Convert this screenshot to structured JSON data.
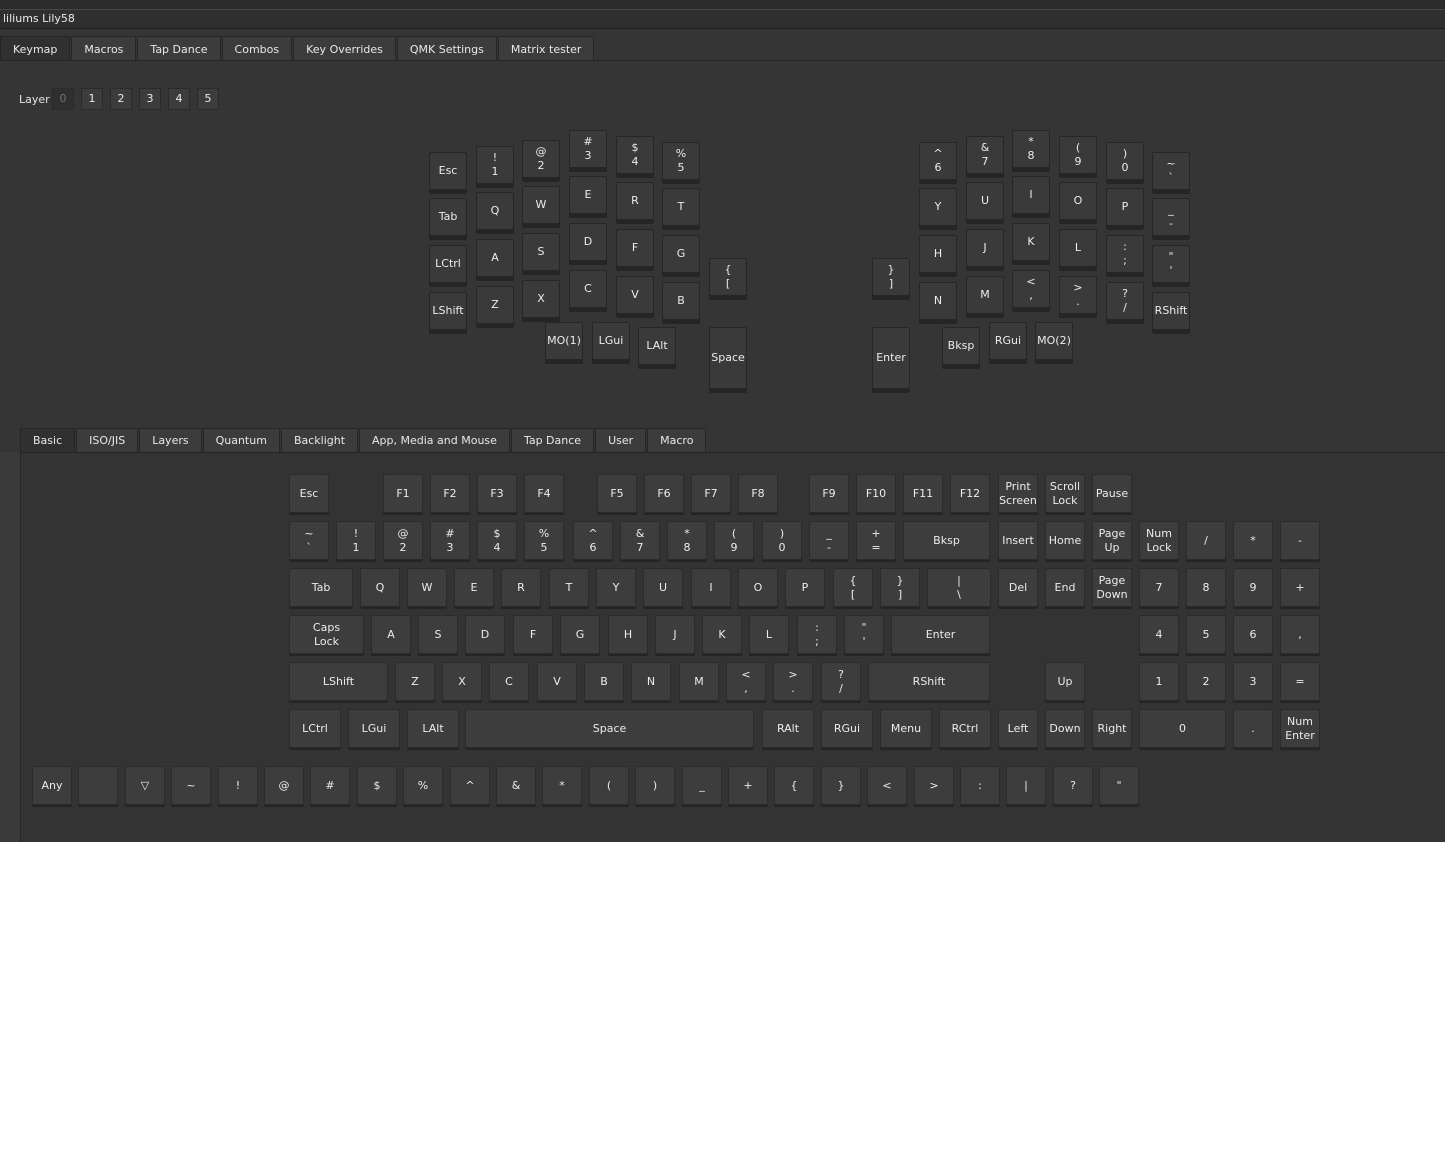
{
  "window": {
    "title": "liliums Lily58"
  },
  "main_tabs": [
    "Keymap",
    "Macros",
    "Tap Dance",
    "Combos",
    "Key Overrides",
    "QMK Settings",
    "Matrix tester"
  ],
  "layer": {
    "label": "Layer",
    "options": [
      "0",
      "1",
      "2",
      "3",
      "4",
      "5"
    ],
    "selected": "0"
  },
  "keyboard": {
    "left": [
      "Esc",
      "!\n1",
      "@\n2",
      "#\n3",
      "$\n4",
      "%\n5",
      "Tab",
      "Q",
      "W",
      "E",
      "R",
      "T",
      "LCtrl",
      "A",
      "S",
      "D",
      "F",
      "G",
      "LShift",
      "Z",
      "X",
      "C",
      "V",
      "B",
      "{\n[",
      "MO(1)",
      "LGui",
      "LAlt",
      "Space"
    ],
    "right": [
      "^\n6",
      "&\n7",
      "*\n8",
      "(\n9",
      ")\n0",
      "~\n`",
      "Y",
      "U",
      "I",
      "O",
      "P",
      "_\n-",
      "H",
      "J",
      "K",
      "L",
      ":\n;",
      "\"\n'",
      "}\n]",
      "N",
      "M",
      "<\n,",
      ">\n.",
      "?\n/",
      "RShift",
      "Enter",
      "Bksp",
      "RGui",
      "MO(2)"
    ]
  },
  "category_tabs": [
    "Basic",
    "ISO/JIS",
    "Layers",
    "Quantum",
    "Backlight",
    "App, Media and Mouse",
    "Tap Dance",
    "User",
    "Macro"
  ],
  "basic_keys": {
    "row1": [
      "Esc",
      "F1",
      "F2",
      "F3",
      "F4",
      "F5",
      "F6",
      "F7",
      "F8",
      "F9",
      "F10",
      "F11",
      "F12",
      "Print\nScreen",
      "Scroll\nLock",
      "Pause"
    ],
    "row2": [
      "~\n`",
      "!\n1",
      "@\n2",
      "#\n3",
      "$\n4",
      "%\n5",
      "^\n6",
      "&\n7",
      "*\n8",
      "(\n9",
      ")\n0",
      "_\n-",
      "+\n=",
      "Bksp",
      "Insert",
      "Home",
      "Page\nUp",
      "Num\nLock",
      "/",
      "*",
      "-"
    ],
    "row3": [
      "Tab",
      "Q",
      "W",
      "E",
      "R",
      "T",
      "Y",
      "U",
      "I",
      "O",
      "P",
      "{\n[",
      "}\n]",
      "|\n\\",
      "Del",
      "End",
      "Page\nDown",
      "7",
      "8",
      "9",
      "+"
    ],
    "row4": [
      "Caps\nLock",
      "A",
      "S",
      "D",
      "F",
      "G",
      "H",
      "J",
      "K",
      "L",
      ":\n;",
      "\"\n'",
      "Enter",
      "4",
      "5",
      "6",
      ","
    ],
    "row5": [
      "LShift",
      "Z",
      "X",
      "C",
      "V",
      "B",
      "N",
      "M",
      "<\n,",
      ">\n.",
      "?\n/",
      "RShift",
      "Up",
      "1",
      "2",
      "3",
      "="
    ],
    "row6": [
      "LCtrl",
      "LGui",
      "LAlt",
      "Space",
      "RAlt",
      "RGui",
      "Menu",
      "RCtrl",
      "Left",
      "Down",
      "Right",
      "0",
      ".",
      "Num\nEnter"
    ]
  },
  "symbol_keys": [
    "Any",
    "",
    "▽",
    "~",
    "!",
    "@",
    "#",
    "$",
    "%",
    "^",
    "&",
    "*",
    "(",
    ")",
    "_",
    "+",
    "{",
    "}",
    "<",
    ">",
    ":",
    "|",
    "?",
    "\""
  ]
}
